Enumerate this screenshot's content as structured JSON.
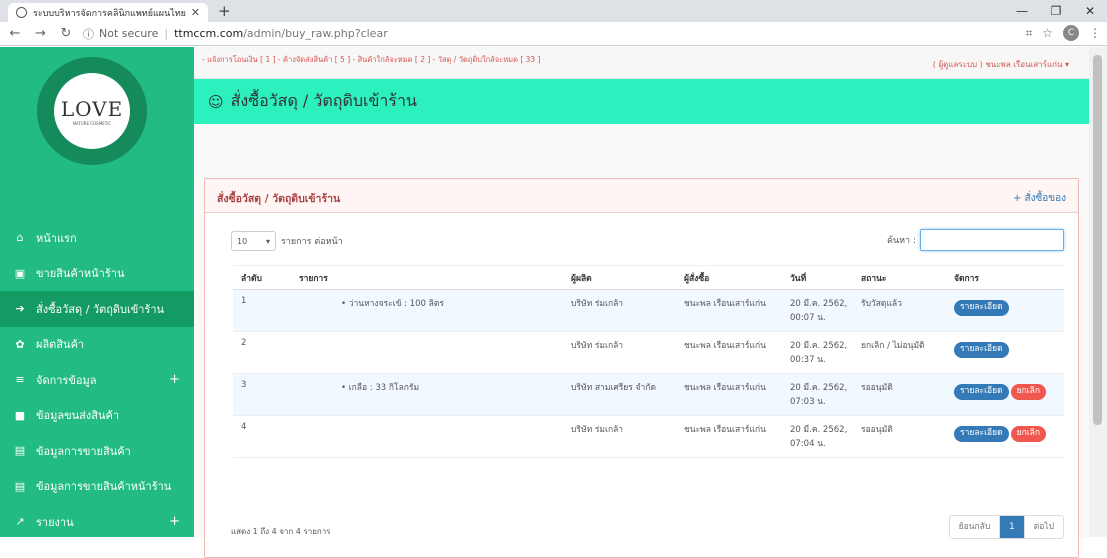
{
  "browser": {
    "tab_title": "ระบบบริหารจัดการคลินิกแพทย์แผนไทย",
    "new_tab": "+",
    "url_info": "ⓘ",
    "not_secure": "Not secure",
    "url_host": "ttmccm.com",
    "url_path": "/admin/buy_raw.php?clear",
    "profile_initial": "C"
  },
  "logo": {
    "word": "LOVE",
    "sub": "NATURE COSMETIC",
    "ring_top": "NATURE ENERGY BRAND",
    "ring_bottom": "EXTRA CLEAN SOAP"
  },
  "sidebar": {
    "items": [
      {
        "icon": "home-icon",
        "glyph": "⌂",
        "label": "หน้าแรก"
      },
      {
        "icon": "pos-icon",
        "glyph": "▣",
        "label": "ขายสินค้าหน้าร้าน"
      },
      {
        "icon": "sign-in-icon",
        "glyph": "➔",
        "label": "สั่งซื้อวัสดุ / วัตถุดิบเข้าร้าน"
      },
      {
        "icon": "gear-icon",
        "glyph": "✿",
        "label": "ผลิตสินค้า"
      },
      {
        "icon": "list-icon",
        "glyph": "≡",
        "label": "จัดการข้อมูล",
        "plus": "+"
      },
      {
        "icon": "truck-icon",
        "glyph": "■",
        "label": "ข้อมูลขนส่งสินค้า"
      },
      {
        "icon": "file-icon",
        "glyph": "▤",
        "label": "ข้อมูลการขายสินค้า"
      },
      {
        "icon": "file-icon",
        "glyph": "▤",
        "label": "ข้อมูลการขายสินค้าหน้าร้าน"
      },
      {
        "icon": "chart-icon",
        "glyph": "↗",
        "label": "รายงาน",
        "plus": "+"
      }
    ]
  },
  "topbar": {
    "alerts": "- แจ้งการโอนเงิน [ 1 ]  - ค้างจัดส่งสินค้า [ 5 ]  - สินค้าใกล้จะหมด [ 2 ]  - วัสดุ / วัตถุดิบใกล้จะหมด [ 33 ]",
    "user": "( ผู้ดูแลระบบ ) ชนะพล เรือนเสาร์แก่น ▾"
  },
  "header": {
    "icon": "☺",
    "title": "สั่งซื้อวัสดุ / วัตถุดิบเข้าร้าน"
  },
  "panel": {
    "title": "สั่งซื้อวัสดุ / วัตถุดิบเข้าร้าน",
    "action": "+ สั่งซื้อของ",
    "length_value": "10",
    "length_label": "รายการ ต่อหน้า",
    "search_label": "ค้นหา :",
    "columns": [
      "ลำดับ",
      "รายการ",
      "ผู้ผลิต",
      "ผู้สั่งซื้อ",
      "วันที่",
      "สถานะ",
      "จัดการ"
    ],
    "rows": [
      {
        "no": "1",
        "item": "•  ว่านหางจระเข้ : 100 ลิตร",
        "maker": "บริษัท ร่มเกล้า",
        "buyer": "ชนะพล เรือนเสาร์แก่น",
        "date": "20 มี.ค. 2562,",
        "time": "00:07 น.",
        "status": "รับวัสดุแล้ว",
        "detail": "รายละเอียด",
        "cancel": ""
      },
      {
        "no": "2",
        "item": "",
        "maker": "บริษัท ร่มเกล้า",
        "buyer": "ชนะพล เรือนเสาร์แก่น",
        "date": "20 มี.ค. 2562,",
        "time": "00:37 น.",
        "status": "ยกเลิก / ไม่อนุมัติ",
        "detail": "รายละเอียด",
        "cancel": ""
      },
      {
        "no": "3",
        "item": "•  เกลือ : 33 กิโลกรัม",
        "maker": "บริษัท สามเศรียร จำกัด",
        "buyer": "ชนะพล เรือนเสาร์แก่น",
        "date": "20 มี.ค. 2562,",
        "time": "07:03 น.",
        "status": "รออนุมัติ",
        "detail": "รายละเอียด",
        "cancel": "ยกเลิก"
      },
      {
        "no": "4",
        "item": "",
        "maker": "บริษัท ร่มเกล้า",
        "buyer": "ชนะพล เรือนเสาร์แก่น",
        "date": "20 มี.ค. 2562,",
        "time": "07:04 น.",
        "status": "รออนุมัติ",
        "detail": "รายละเอียด",
        "cancel": "ยกเลิก"
      }
    ],
    "info": "แสดง 1 ถึง 4 จาก 4 รายการ",
    "prev": "ย้อนกลับ",
    "page": "1",
    "next": "ต่อไป"
  }
}
